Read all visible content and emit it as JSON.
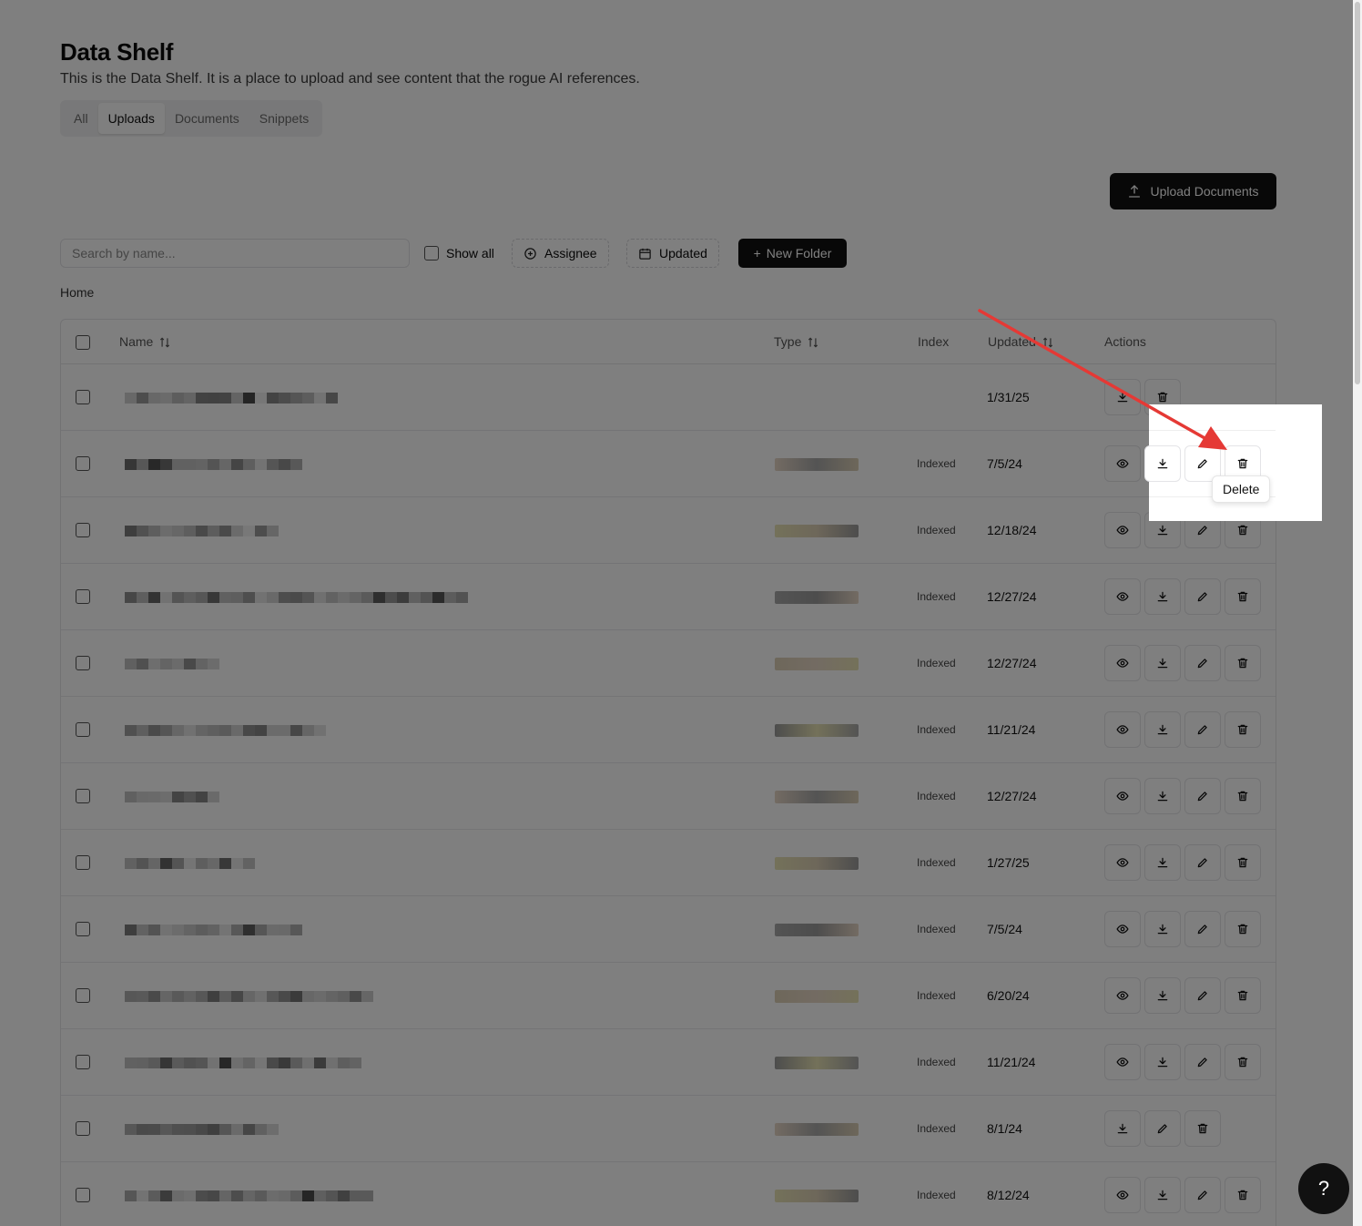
{
  "page": {
    "title": "Data Shelf",
    "subtitle": "This is the Data Shelf. It is a place to upload and see content that the rogue AI references."
  },
  "tabs": [
    {
      "label": "All",
      "active": false
    },
    {
      "label": "Uploads",
      "active": true
    },
    {
      "label": "Documents",
      "active": false
    },
    {
      "label": "Snippets",
      "active": false
    }
  ],
  "upload_button": {
    "label": "Upload Documents",
    "icon": "upload-icon"
  },
  "toolbar": {
    "search_placeholder": "Search by name...",
    "show_all_label": "Show all",
    "assignee_label": "Assignee",
    "assignee_icon": "plus-circle-icon",
    "updated_label": "Updated",
    "updated_icon": "calendar-icon",
    "new_folder_label": "New Folder"
  },
  "breadcrumb": "Home",
  "table": {
    "headers": {
      "name": "Name",
      "type": "Type",
      "index": "Index",
      "updated": "Updated",
      "actions": "Actions"
    },
    "rows": [
      {
        "index": "",
        "updated": "1/31/25",
        "actions": [
          "download",
          "delete"
        ]
      },
      {
        "index": "Indexed",
        "updated": "7/5/24",
        "actions": [
          "view",
          "download",
          "edit",
          "delete"
        ]
      },
      {
        "index": "Indexed",
        "updated": "12/18/24",
        "actions": [
          "view",
          "download",
          "edit",
          "delete"
        ]
      },
      {
        "index": "Indexed",
        "updated": "12/27/24",
        "actions": [
          "view",
          "download",
          "edit",
          "delete"
        ]
      },
      {
        "index": "Indexed",
        "updated": "12/27/24",
        "actions": [
          "view",
          "download",
          "edit",
          "delete"
        ]
      },
      {
        "index": "Indexed",
        "updated": "11/21/24",
        "actions": [
          "view",
          "download",
          "edit",
          "delete"
        ]
      },
      {
        "index": "Indexed",
        "updated": "12/27/24",
        "actions": [
          "view",
          "download",
          "edit",
          "delete"
        ]
      },
      {
        "index": "Indexed",
        "updated": "1/27/25",
        "actions": [
          "view",
          "download",
          "edit",
          "delete"
        ]
      },
      {
        "index": "Indexed",
        "updated": "7/5/24",
        "actions": [
          "view",
          "download",
          "edit",
          "delete"
        ]
      },
      {
        "index": "Indexed",
        "updated": "6/20/24",
        "actions": [
          "view",
          "download",
          "edit",
          "delete"
        ]
      },
      {
        "index": "Indexed",
        "updated": "11/21/24",
        "actions": [
          "view",
          "download",
          "edit",
          "delete"
        ]
      },
      {
        "index": "Indexed",
        "updated": "8/1/24",
        "actions": [
          "download",
          "edit",
          "delete"
        ]
      },
      {
        "index": "Indexed",
        "updated": "8/12/24",
        "actions": [
          "view",
          "download",
          "edit",
          "delete"
        ]
      }
    ]
  },
  "tooltip": {
    "label": "Delete"
  },
  "help_button": {
    "label": "?"
  },
  "colors": {
    "overlay": "#000000",
    "arrow": "#e53935",
    "primary": "#111111"
  }
}
